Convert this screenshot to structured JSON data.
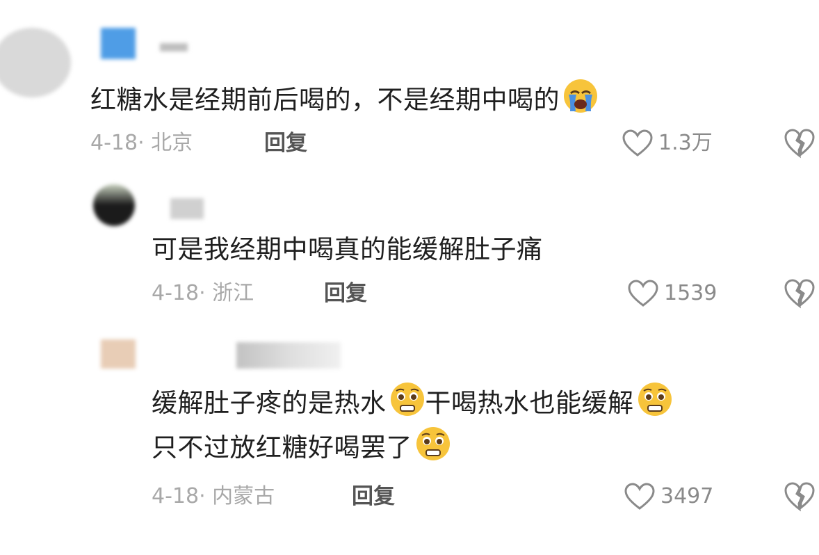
{
  "comments": [
    {
      "text": "红糖水是经期前后喝的，不是经期中喝的",
      "emoji": "crying-face",
      "date_loc": "4-18· 北京",
      "reply": "回复",
      "likes": "1.3万"
    },
    {
      "text": "可是我经期中喝真的能缓解肚子痛",
      "date_loc": "4-18· 浙江",
      "reply": "回复",
      "likes": "1539"
    },
    {
      "text_line1_a": "缓解肚子疼的是热水",
      "text_line1_b": "干喝热水也能缓解",
      "text_line2": "只不过放红糖好喝罢了",
      "emoji": "pleading-grimace-face",
      "date_loc": "4-18· 内蒙古",
      "reply": "回复",
      "likes": "3497"
    }
  ],
  "colors": {
    "text": "#1f1f1f",
    "meta": "#a8a8a8",
    "emoji_yellow": "#f7c43b",
    "tear_blue": "#4a90e2"
  }
}
